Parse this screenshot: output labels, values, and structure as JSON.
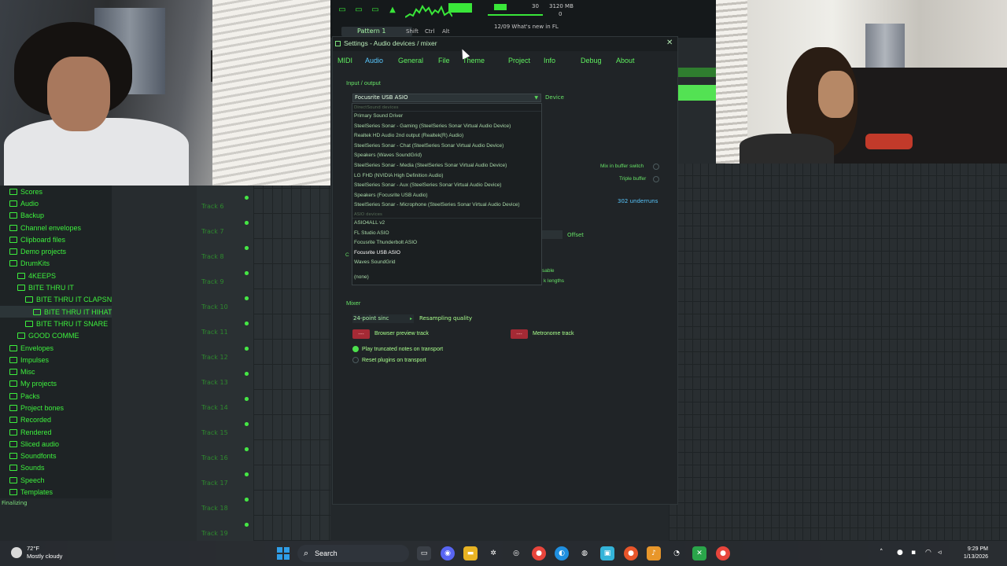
{
  "fl_studio": {
    "pattern_label": "Pattern 1",
    "cpu_memory": "3120 MB",
    "cpu_count": "30",
    "cpu_other": "0",
    "hint_text": "12/09  What's new in FL",
    "toolbar_labels": [
      "Shift",
      "Ctrl",
      "Alt"
    ],
    "finalizing": "Finalizing"
  },
  "browser": {
    "items": [
      {
        "label": "Scores",
        "indent": 0
      },
      {
        "label": "Audio",
        "indent": 0
      },
      {
        "label": "Backup",
        "indent": 0
      },
      {
        "label": "Channel envelopes",
        "indent": 0
      },
      {
        "label": "Clipboard files",
        "indent": 0
      },
      {
        "label": "Demo projects",
        "indent": 0
      },
      {
        "label": "DrumKits",
        "indent": 0
      },
      {
        "label": "4KEEPS",
        "indent": 1
      },
      {
        "label": "BITE THRU IT",
        "indent": 1
      },
      {
        "label": "BITE THRU IT CLAPSNARE",
        "indent": 2
      },
      {
        "label": "BITE THRU IT HIHAT",
        "indent": 3
      },
      {
        "label": "BITE THRU IT SNARE",
        "indent": 2
      },
      {
        "label": "GOOD COMME",
        "indent": 1
      },
      {
        "label": "Envelopes",
        "indent": 0
      },
      {
        "label": "Impulses",
        "indent": 0
      },
      {
        "label": "Misc",
        "indent": 0
      },
      {
        "label": "My projects",
        "indent": 0
      },
      {
        "label": "Packs",
        "indent": 0
      },
      {
        "label": "Project bones",
        "indent": 0
      },
      {
        "label": "Recorded",
        "indent": 0
      },
      {
        "label": "Rendered",
        "indent": 0
      },
      {
        "label": "Sliced audio",
        "indent": 0
      },
      {
        "label": "Soundfonts",
        "indent": 0
      },
      {
        "label": "Sounds",
        "indent": 0
      },
      {
        "label": "Speech",
        "indent": 0
      },
      {
        "label": "Templates",
        "indent": 0
      }
    ]
  },
  "playlist": {
    "tracks": [
      "Track 6",
      "Track 7",
      "Track 8",
      "Track 9",
      "Track 10",
      "Track 11",
      "Track 12",
      "Track 13",
      "Track 14",
      "Track 15",
      "Track 16",
      "Track 17",
      "Track 18",
      "Track 19"
    ]
  },
  "dialog": {
    "title": "Settings - Audio devices / mixer",
    "close_glyph": "✕",
    "tabs": [
      "MIDI",
      "Audio",
      "General",
      "File",
      "Theme",
      "Project",
      "Info",
      "Debug",
      "About"
    ],
    "active_tab": "Audio",
    "input_output_label": "Input / output",
    "device_label": "Device",
    "selected_device": "Focusrite USB ASIO",
    "dropdown": {
      "group_directsound": "DirectSound devices",
      "directsound_items": [
        "Primary Sound Driver",
        "SteelSeries Sonar - Gaming (SteelSeries Sonar Virtual Audio Device)",
        "Realtek HD Audio 2nd output (Realtek(R) Audio)",
        "SteelSeries Sonar - Chat (SteelSeries Sonar Virtual Audio Device)",
        "Speakers (Waves SoundGrid)",
        "SteelSeries Sonar - Media (SteelSeries Sonar Virtual Audio Device)",
        "LG FHD (NVIDIA High Definition Audio)",
        "SteelSeries Sonar - Aux (SteelSeries Sonar Virtual Audio Device)",
        "Speakers (Focusrite USB Audio)",
        "SteelSeries Sonar - Microphone (SteelSeries Sonar Virtual Audio Device)"
      ],
      "group_asio": "ASIO devices",
      "asio_items": [
        "ASIO4ALL v2",
        "FL Studio ASIO",
        "Focusrite Thunderbolt ASIO",
        "Focusrite USB ASIO",
        "Waves SoundGrid"
      ],
      "none_item": "(none)"
    },
    "mix_in_buffer_switch": "Mix in buffer switch",
    "triple_buffer": "Triple buffer",
    "underruns": "302 underruns",
    "offset_label": "Offset",
    "partial_text_1": "sable",
    "partial_text_2": "k lengths",
    "mixer_label": "Mixer",
    "interpolation": "24-point sinc",
    "resampling_quality": "Resampling quality",
    "browser_preview_track": "Browser preview track",
    "metronome_track": "Metronome track",
    "play_truncated": "Play truncated notes on transport",
    "reset_plugins": "Reset plugins on transport",
    "red_button_glyph": "---"
  },
  "taskbar": {
    "weather_temp": "72°F",
    "weather_desc": "Mostly cloudy",
    "search_placeholder": "Search",
    "time": "9:29 PM",
    "date": "1/13/2026"
  },
  "colors": {
    "accent_green": "#3df03d",
    "active_tab_blue": "#58c8ff",
    "red_button": "#a52a35"
  }
}
